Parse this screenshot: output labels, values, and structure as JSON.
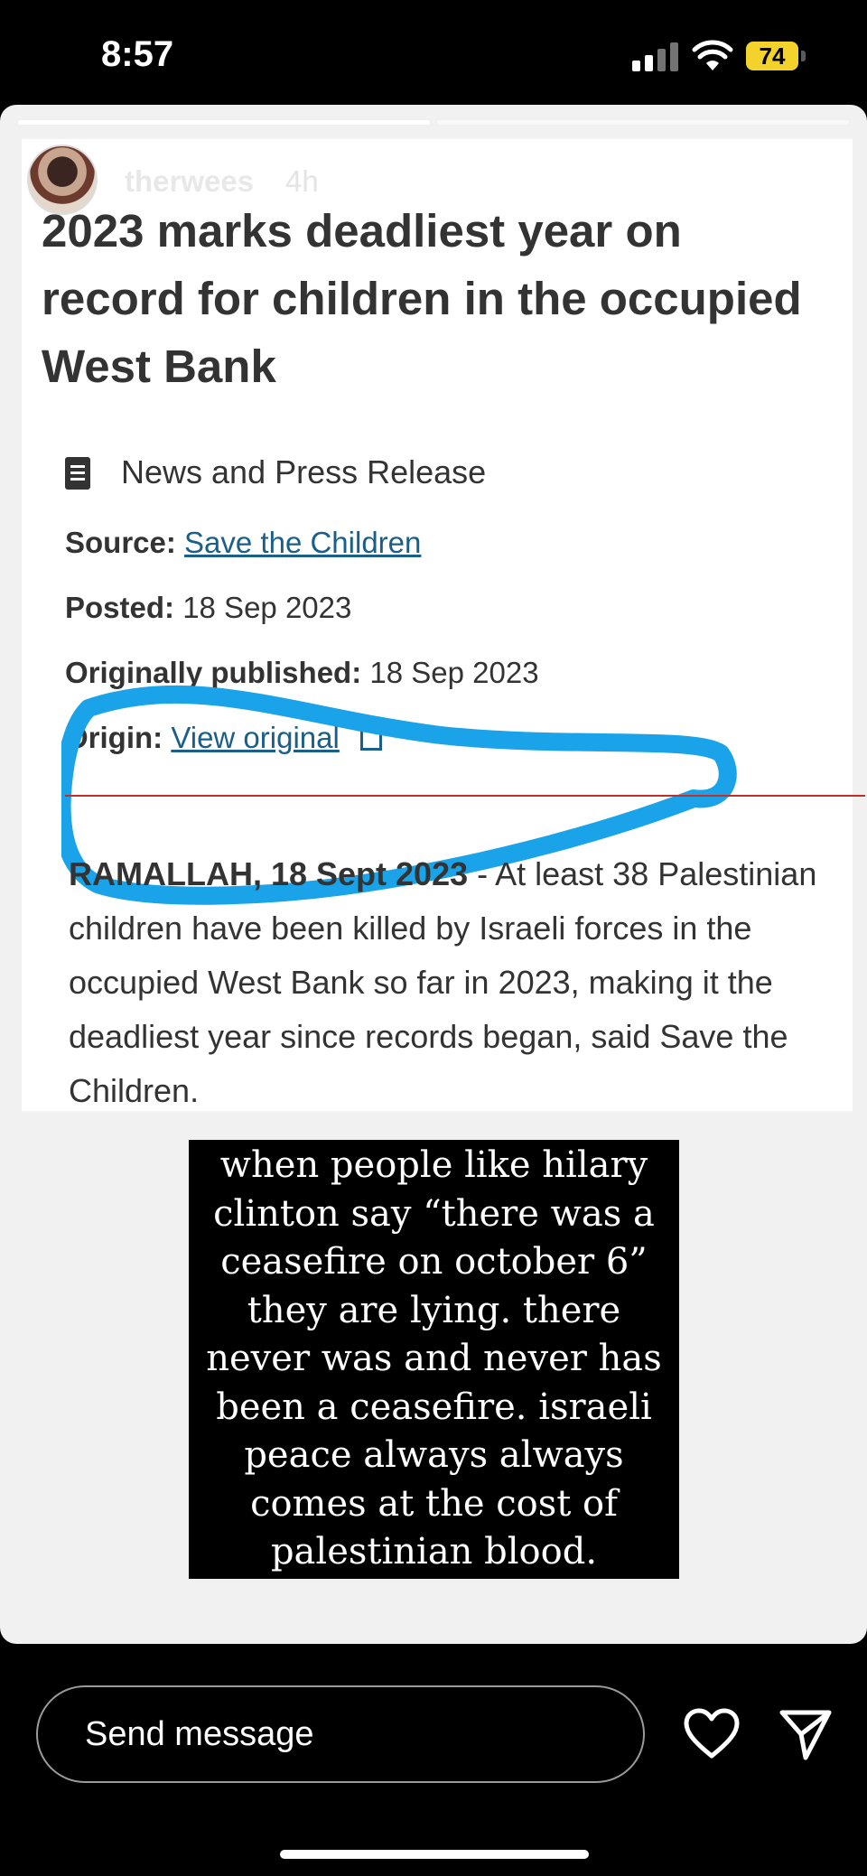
{
  "status_bar": {
    "time": "8:57",
    "battery": "74",
    "battery_color": "#f2d22b"
  },
  "story": {
    "username": "therwees",
    "time_ago": "4h",
    "progress": [
      1.0,
      0.0
    ],
    "icons": {
      "more": "more-dots-icon",
      "close": "close-icon"
    }
  },
  "article": {
    "headline": "2023 marks deadliest year on record for children in the occupied West Bank",
    "doc_type": "News and Press Release",
    "source_label": "Source:",
    "source_value": "Save the Children",
    "posted_label": "Posted:",
    "posted_value": "18 Sep 2023",
    "orig_label": "Originally published:",
    "orig_value": "18 Sep 2023",
    "origin_label": "Origin:",
    "origin_value": "View original",
    "dateline": "RAMALLAH, 18 Sept 2023",
    "body": " - At least 38 Palestinian children have been killed by Israeli forces in the occupied West Bank so far in 2023, making it the deadliest year since records began, said Save the Children.",
    "link_color": "#1a5f8a",
    "scribble_color": "#1aa3e8"
  },
  "caption": "when people like hilary clinton say “there was a ceasefire on october 6” they are lying. there never was and never has been a ceasefire. israeli peace always always comes at the cost of palestinian blood.",
  "bottom_bar": {
    "message_placeholder": "Send message",
    "icons": {
      "like": "heart-icon",
      "send": "send-icon"
    }
  }
}
